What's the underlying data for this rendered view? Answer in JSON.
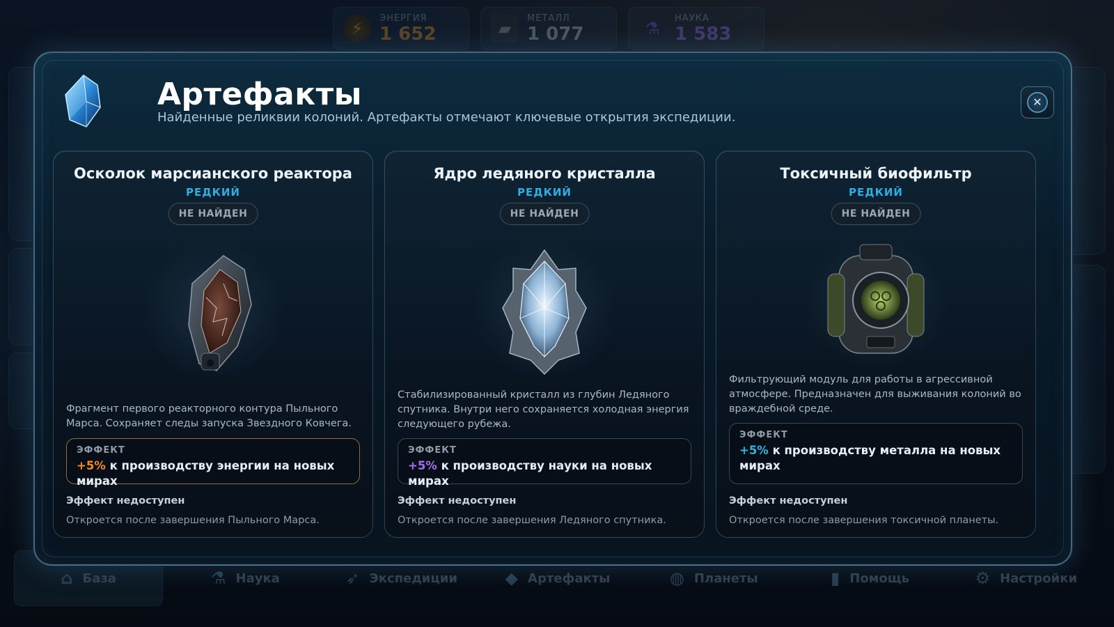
{
  "resources": [
    {
      "label": "ЭНЕРГИЯ",
      "value": "1 652",
      "icon": "lightning-icon",
      "color": "#e29a2a"
    },
    {
      "label": "МЕТАЛЛ",
      "value": "1 077",
      "icon": "metal-ingot-icon",
      "color": "#b9c4cf"
    },
    {
      "label": "НАУКА",
      "value": "1 583",
      "icon": "flask-icon",
      "color": "#8f6ee6"
    }
  ],
  "nav": [
    {
      "label": "База",
      "icon": "base-icon"
    },
    {
      "label": "Наука",
      "icon": "flask-icon"
    },
    {
      "label": "Экспедиции",
      "icon": "rocket-icon"
    },
    {
      "label": "Артефакты",
      "icon": "crystal-icon"
    },
    {
      "label": "Планеты",
      "icon": "planet-icon"
    },
    {
      "label": "Помощь",
      "icon": "chart-icon"
    },
    {
      "label": "Настройки",
      "icon": "gear-icon"
    }
  ],
  "modal": {
    "title": "Артефакты",
    "subtitle": "Найденные реликвии колоний. Артефакты отмечают ключевые открытия экспедиции.",
    "close_icon": "close-icon"
  },
  "cards": [
    {
      "name": "Осколок марсианского реактора",
      "rarity": "РЕДКИЙ",
      "status": "НЕ НАЙДЕН",
      "description": "Фрагмент первого реакторного контура Пыльного Марса. Сохраняет следы запуска Звездного Ковчега.",
      "effect_label": "ЭФФЕКТ",
      "effect_pct": "+5%",
      "effect_text": " к производству энергии на новых мирах",
      "effect_color": "#f08a22",
      "effect_unavailable": "Эффект недоступен",
      "unlock": "Откроется после завершения Пыльного Марса."
    },
    {
      "name": "Ядро ледяного кристалла",
      "rarity": "РЕДКИЙ",
      "status": "НЕ НАЙДЕН",
      "description": "Стабилизированный кристалл из глубин Ледяного спутника. Внутри него сохраняется холодная энергия следующего рубежа.",
      "effect_label": "ЭФФЕКТ",
      "effect_pct": "+5%",
      "effect_text": " к производству науки на новых мирах",
      "effect_color": "#a46ef0",
      "effect_unavailable": "Эффект недоступен",
      "unlock": "Откроется после завершения Ледяного спутника."
    },
    {
      "name": "Токсичный биофильтр",
      "rarity": "РЕДКИЙ",
      "status": "НЕ НАЙДЕН",
      "description": "Фильтрующий модуль для работы в агрессивной атмосфере. Предназначен для выживания колоний во враждебной среде.",
      "effect_label": "ЭФФЕКТ",
      "effect_pct": "+5%",
      "effect_text": " к производству металла на новых мирах",
      "effect_color": "#2fb6e0",
      "effect_unavailable": "Эффект недоступен",
      "unlock": "Откроется после завершения токсичной планеты."
    }
  ]
}
